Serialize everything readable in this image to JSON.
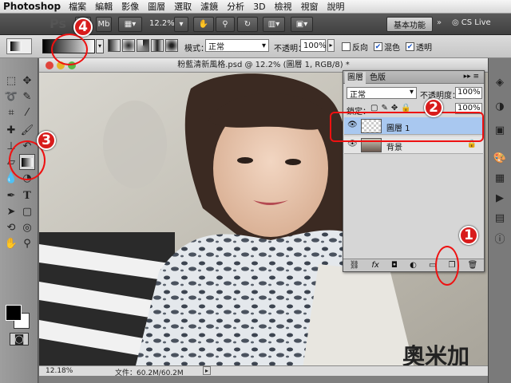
{
  "menubar": {
    "app": "Photoshop",
    "items": [
      "檔案",
      "編輯",
      "影像",
      "圖層",
      "選取",
      "濾鏡",
      "分析",
      "3D",
      "檢視",
      "視窗",
      "說明"
    ]
  },
  "appbar": {
    "logo": "Ps",
    "bridge": "Br",
    "minibridge": "Mb",
    "zoom": "12.2%",
    "workspace": "基本功能",
    "more": "»",
    "cslive": "CS Live"
  },
  "options": {
    "mode_label": "模式：",
    "mode_value": "正常",
    "opacity_label": "不透明：",
    "opacity_value": "100%",
    "reverse": "反向",
    "dither": "混色",
    "transparency": "透明",
    "reverse_checked": false,
    "dither_checked": true,
    "transparency_checked": true
  },
  "document": {
    "title": "粉藍清新風格.psd @ 12.2% (圖層 1, RGB/8) *",
    "zoom_status": "12.18%",
    "file_info": "文件：60.2M/60.2M"
  },
  "layers_panel": {
    "tab_layers": "圖層",
    "tab_channels": "色版",
    "blend": "正常",
    "opacity_label": "不透明度：",
    "opacity_value": "100%",
    "lock_label": "鎖定：",
    "fill_value": "100%",
    "layers": [
      {
        "name": "圖層 1",
        "selected": true
      },
      {
        "name": "背景",
        "selected": false
      }
    ]
  },
  "callouts": [
    "1",
    "2",
    "3",
    "4"
  ],
  "watermark": "奧米加"
}
